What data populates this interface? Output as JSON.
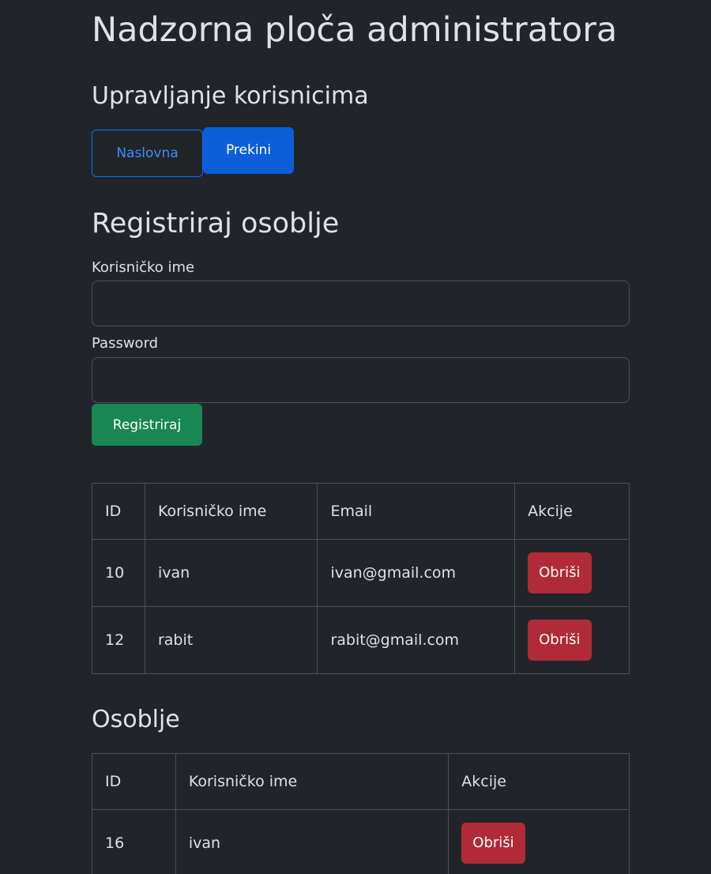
{
  "page": {
    "title": "Nadzorna ploča administratora",
    "section_title": "Upravljanje korisnicima"
  },
  "nav": {
    "home_label": "Naslovna",
    "cancel_label": "Prekini"
  },
  "register_form": {
    "title": "Registriraj osoblje",
    "username_label": "Korisničko ime",
    "username_value": "",
    "username_placeholder": "",
    "password_label": "Password",
    "password_value": "",
    "password_placeholder": "",
    "submit_label": "Registriraj"
  },
  "users_table": {
    "headers": [
      "ID",
      "Korisničko ime",
      "Email",
      "Akcije"
    ],
    "rows": [
      {
        "id": "10",
        "username": "ivan",
        "email": "ivan@gmail.com",
        "action": "Obriši"
      },
      {
        "id": "12",
        "username": "rabit",
        "email": "rabit@gmail.com",
        "action": "Obriši"
      }
    ]
  },
  "staff": {
    "title": "Osoblje",
    "headers": [
      "ID",
      "Korisničko ime",
      "Akcije"
    ],
    "rows": [
      {
        "id": "16",
        "username": "ivan",
        "action": "Obriši"
      }
    ]
  },
  "colors": {
    "background": "#212529",
    "primary": "#0b5ed7",
    "success": "#198754",
    "danger": "#b02a37",
    "border": "#495057"
  }
}
